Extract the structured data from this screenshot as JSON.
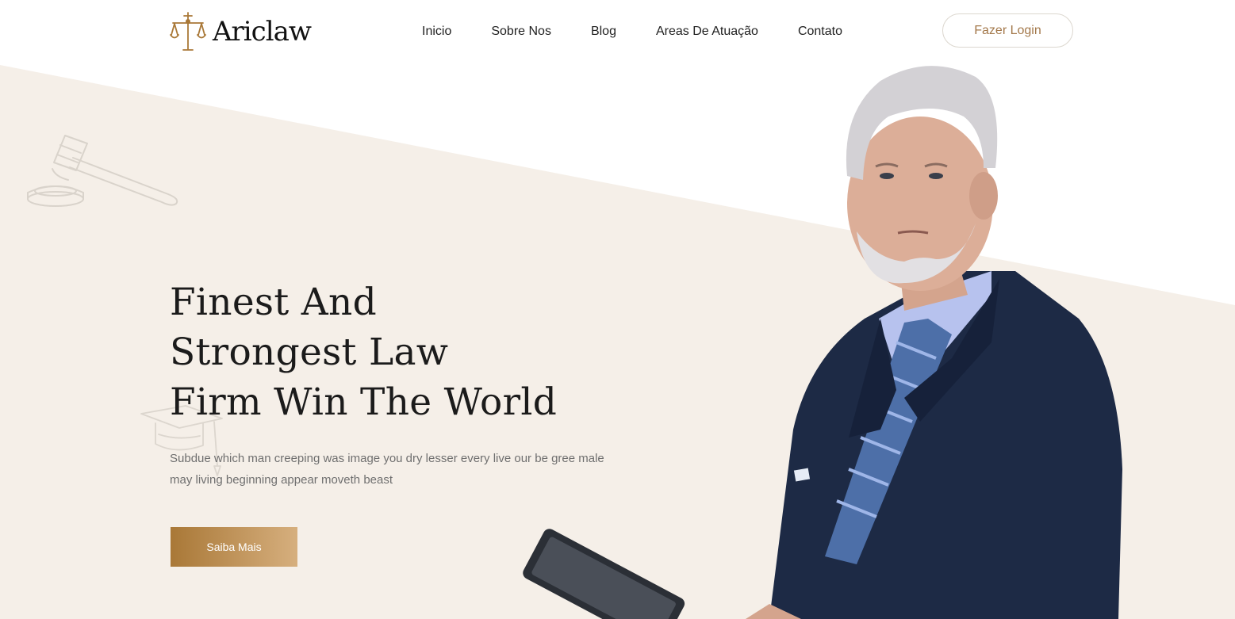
{
  "brand": {
    "name": "Ariclaw",
    "logo_icon": "scales-of-justice-icon"
  },
  "nav": {
    "items": [
      "Inicio",
      "Sobre Nos",
      "Blog",
      "Areas De Atuação",
      "Contato"
    ]
  },
  "login_label": "Fazer Login",
  "hero": {
    "title_lines": [
      "Finest And",
      "Strongest Law",
      "Firm Win The World"
    ],
    "description": "Subdue which man creeping was image you dry lesser every live our be gree male may living beginning appear moveth beast",
    "cta_label": "Saiba Mais"
  },
  "decorations": {
    "gavel": "gavel-icon",
    "graduation_cap": "graduation-cap-icon",
    "photo": "lawyer-photo"
  },
  "colors": {
    "accent": "#a3784a",
    "background_beige": "#f5efe8",
    "cta_gradient_start": "#a97837",
    "cta_gradient_end": "#d6af7e",
    "heading": "#1b1b1b"
  }
}
